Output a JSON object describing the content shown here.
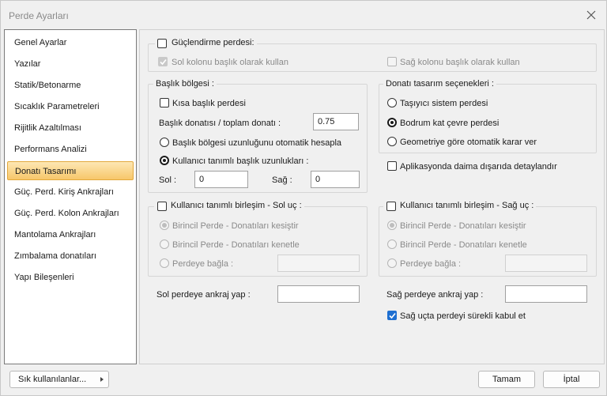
{
  "window": {
    "title": "Perde Ayarları"
  },
  "sidebar": {
    "items": [
      {
        "label": "Genel Ayarlar"
      },
      {
        "label": "Yazılar"
      },
      {
        "label": "Statik/Betonarme"
      },
      {
        "label": "Sıcaklık Parametreleri"
      },
      {
        "label": "Rijitlik Azaltılması"
      },
      {
        "label": "Performans Analizi"
      },
      {
        "label": "Donatı Tasarımı",
        "selected": true
      },
      {
        "label": "Güç. Perd. Kiriş Ankrajları"
      },
      {
        "label": "Güç. Perd. Kolon Ankrajları"
      },
      {
        "label": "Mantolama Ankrajları"
      },
      {
        "label": "Zımbalama donatıları"
      },
      {
        "label": "Yapı Bileşenleri"
      }
    ]
  },
  "strengthening": {
    "title": "Güçlendirme perdesi:",
    "checked": false,
    "left_col_label": "Sol kolonu başlık olarak kullan",
    "left_col_checked": true,
    "right_col_label": "Sağ kolonu başlık olarak kullan",
    "right_col_checked": false
  },
  "header_region": {
    "title": "Başlık bölgesi :",
    "short_header_label": "Kısa başlık perdesi",
    "short_header_checked": false,
    "ratio_label": "Başlık donatısı / toplam donatı :",
    "ratio_value": "0.75",
    "auto_length_label": "Başlık bölgesi uzunluğunu otomatik hesapla",
    "user_length_label": "Kullanıcı tanımlı başlık uzunlukları :",
    "user_length_selected": true,
    "left_label": "Sol :",
    "left_value": "0",
    "right_label": "Sağ :",
    "right_value": "0"
  },
  "rebar_options": {
    "title": "Donatı tasarım seçenekleri :",
    "options": [
      {
        "label": "Taşıyıcı sistem perdesi",
        "selected": false
      },
      {
        "label": "Bodrum kat çevre perdesi",
        "selected": true
      },
      {
        "label": "Geometriye göre otomatik karar ver",
        "selected": false
      }
    ],
    "detail_outside_label": "Aplikasyonda daima dışarıda detaylandır",
    "detail_outside_checked": false
  },
  "left_joint": {
    "title": "Kullanıcı tanımlı birleşim - Sol uç :",
    "checked": false,
    "opt1": "Birincil Perde - Donatıları kesiştir",
    "opt2": "Birincil Perde - Donatıları kenetle",
    "opt3": "Perdeye bağla :",
    "anchor_label": "Sol perdeye ankraj yap :",
    "anchor_value": ""
  },
  "right_joint": {
    "title": "Kullanıcı tanımlı birleşim - Sağ uç :",
    "checked": false,
    "opt1": "Birincil Perde - Donatıları kesiştir",
    "opt2": "Birincil Perde - Donatıları kenetle",
    "opt3": "Perdeye bağla :",
    "anchor_label": "Sağ perdeye ankraj yap :",
    "anchor_value": "",
    "continuous_label": "Sağ uçta perdeyi sürekli kabul et",
    "continuous_checked": true
  },
  "footer": {
    "frequent_label": "Sık kullanılanlar...",
    "ok_label": "Tamam",
    "cancel_label": "İptal"
  },
  "icons": {
    "close": "close-icon",
    "check": "check-icon",
    "menu_arrow": "chevron-right-icon"
  },
  "colors": {
    "accent": "#1e6fd1",
    "selected_item_top": "#fde7b4",
    "selected_item_bottom": "#f7c76a"
  }
}
